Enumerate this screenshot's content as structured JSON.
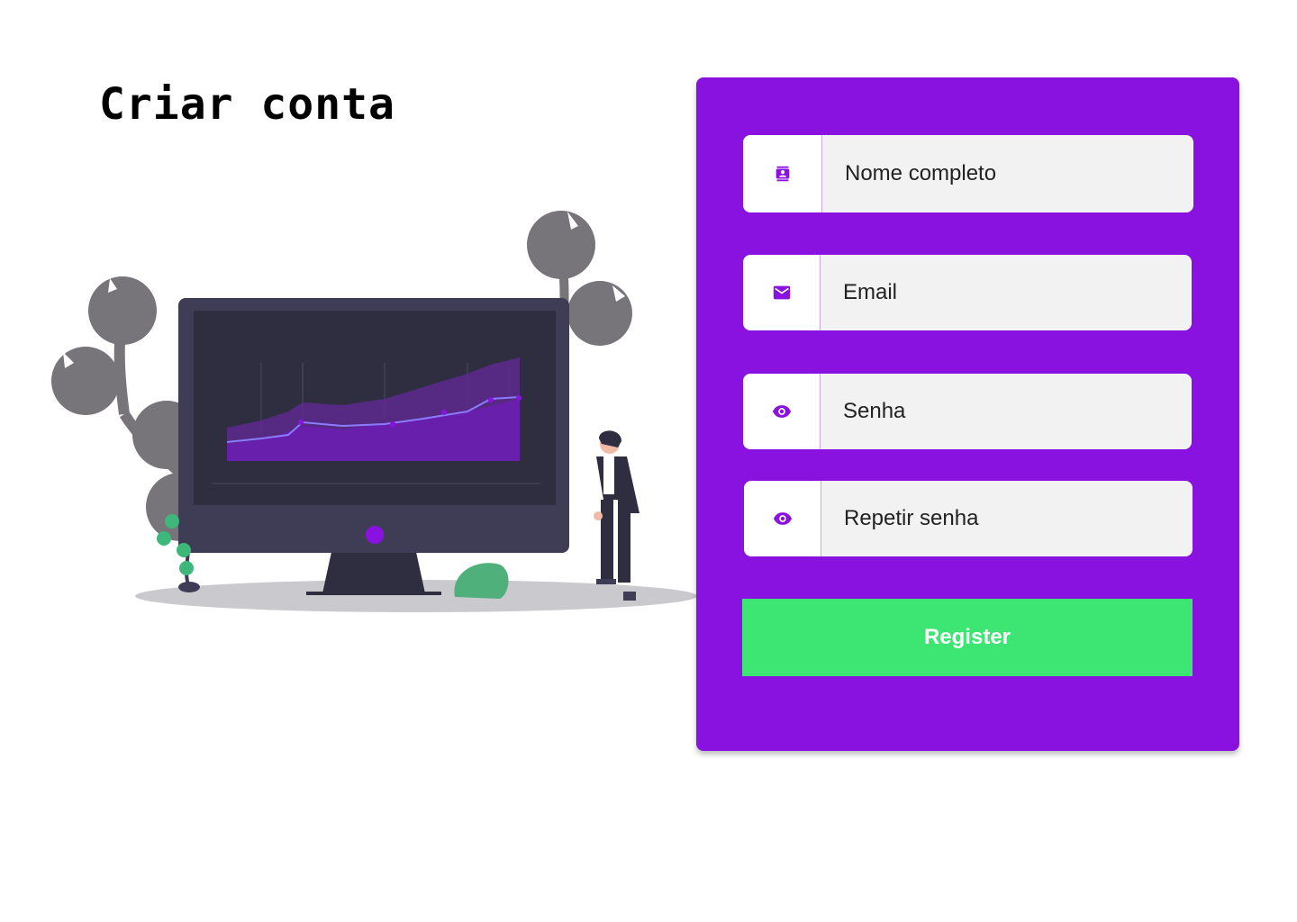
{
  "page": {
    "title": "Criar conta"
  },
  "colors": {
    "accent": "#8a12e0",
    "button": "#3de573",
    "field_bg": "#f2f2f2"
  },
  "form": {
    "fields": [
      {
        "icon": "contact-icon",
        "placeholder": "Nome completo",
        "value": ""
      },
      {
        "icon": "mail-icon",
        "placeholder": "Email",
        "value": ""
      },
      {
        "icon": "eye-icon",
        "placeholder": "Senha",
        "value": ""
      },
      {
        "icon": "eye-icon",
        "placeholder": "Repetir senha",
        "value": ""
      }
    ],
    "submit_label": "Register"
  }
}
